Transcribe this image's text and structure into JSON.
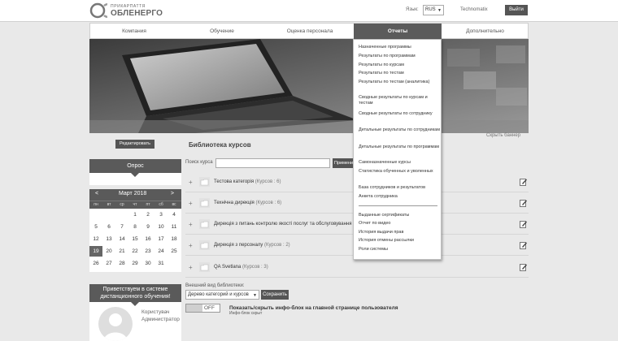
{
  "header": {
    "logo_top": "ПРИКАРПАТТЯ",
    "logo_main": "ОБЛЕНЕРГО",
    "lang_label": "Язык:",
    "lang_value": "RUS",
    "username": "Technomatix",
    "logout_label": "Выйти"
  },
  "nav": {
    "items": [
      {
        "label": "Компания"
      },
      {
        "label": "Обучение"
      },
      {
        "label": "Оценка персонала"
      },
      {
        "label": "Отчеты"
      },
      {
        "label": "Дополнительно"
      }
    ],
    "active_index": 3
  },
  "reports_menu": {
    "items": [
      "Назначенные программы",
      "Результаты по программам",
      "Результаты по курсам",
      "Результаты по тестам",
      "Результаты по тестам (аналитика)",
      "Сводные результаты по курсам и тестам",
      "Сводные результаты по сотруднику",
      "Детальные результаты по сотрудникам",
      "Детальные результаты по программам",
      "Самоназначенные курсы",
      "Статистика обученных и уволенных",
      "База сотрудников и результатов",
      "Анкета сотрудника",
      "Выданные сертификаты",
      "Отчет по видео",
      "История выдачи прав",
      "История отмены рассылки",
      "Роли системы"
    ]
  },
  "banner": {
    "hide_label": "Скрыть баннер"
  },
  "left": {
    "edit_label": "Редактировать",
    "poll_title": "Опрос",
    "calendar": {
      "prev": "<",
      "next": ">",
      "title": "Март 2018",
      "dows": [
        "пн",
        "вт",
        "ср",
        "чт",
        "пт",
        "сб",
        "вс"
      ],
      "weeks": [
        [
          "",
          "",
          "",
          "1",
          "2",
          "3",
          "4"
        ],
        [
          "5",
          "6",
          "7",
          "8",
          "9",
          "10",
          "11"
        ],
        [
          "12",
          "13",
          "14",
          "15",
          "16",
          "17",
          "18"
        ],
        [
          "19",
          "20",
          "21",
          "22",
          "23",
          "24",
          "25"
        ],
        [
          "26",
          "27",
          "28",
          "29",
          "30",
          "31",
          ""
        ]
      ],
      "today": "19"
    },
    "welcome_text": "Приветствуем в системе дистанционного обучения!",
    "profile_name": "Користувач",
    "profile_role": "Администратор"
  },
  "library": {
    "title": "Библиотека курсов",
    "search_label": "Поиск курса",
    "search_value": "",
    "apply_label": "Применить",
    "categories": [
      {
        "name": "Тестова категорія",
        "count": "(Курсов : 6)"
      },
      {
        "name": "Технічна дирекція",
        "count": "(Курсов : 6)"
      },
      {
        "name": "Дирекція з питань контролю якості послуг та обслуговування",
        "count": ""
      },
      {
        "name": "Дирекція з персоналу",
        "count": "(Курсов : 2)"
      },
      {
        "name": "QA Svetlana",
        "count": "(Курсов : 3)"
      }
    ],
    "view_label": "Внешний вид библиотеки:",
    "view_value": "Дерево категорий и курсов",
    "save_label": "Сохранить",
    "toggle_label": "OFF",
    "infoblock_title": "Показать/скрыть инфо-блок на главной странице пользователя",
    "infoblock_sub": "Инфо-блок скрыт"
  }
}
